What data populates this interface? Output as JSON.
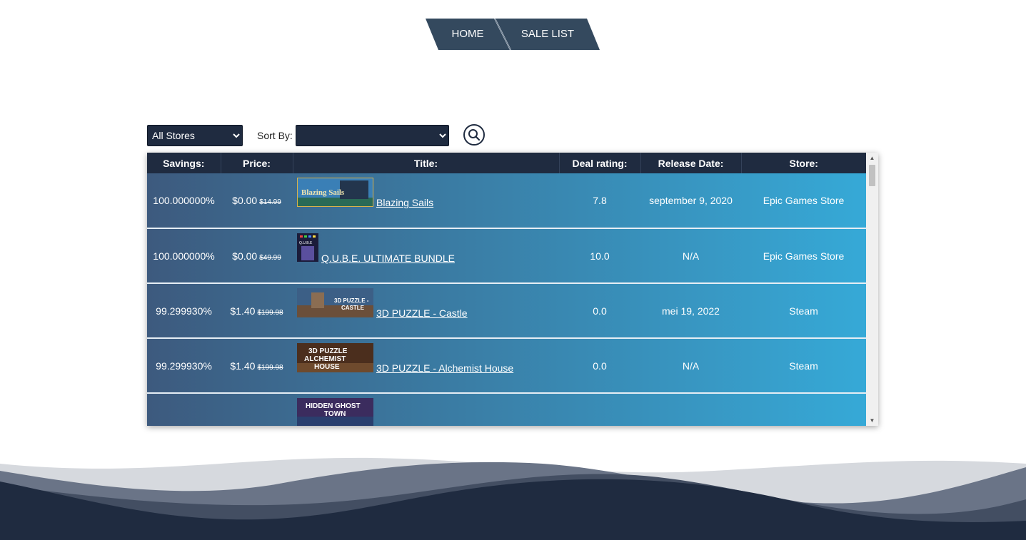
{
  "nav": {
    "home": "HOME",
    "sale_list": "SALE LIST"
  },
  "filters": {
    "store_selected": "All Stores",
    "sort_label": "Sort By:",
    "sort_selected": ""
  },
  "table": {
    "headers": [
      "Savings:",
      "Price:",
      "Title:",
      "Deal rating:",
      "Release Date:",
      "Store:"
    ],
    "rows": [
      {
        "savings": "100.000000%",
        "price": "$0.00",
        "old_price": "$14.99",
        "title": "Blazing Sails",
        "thumb_text": "Blazing Sails",
        "rating": "7.8",
        "release": "september 9, 2020",
        "store": "Epic Games Store"
      },
      {
        "savings": "100.000000%",
        "price": "$0.00",
        "old_price": "$49.99",
        "title": "Q.U.B.E. ULTIMATE BUNDLE",
        "thumb_text": "Q.U.B.E",
        "rating": "10.0",
        "release": "N/A",
        "store": "Epic Games Store"
      },
      {
        "savings": "99.299930%",
        "price": "$1.40",
        "old_price": "$199.98",
        "title": "3D PUZZLE - Castle",
        "thumb_text": "3D PUZZLE - CASTLE",
        "rating": "0.0",
        "release": "mei 19, 2022",
        "store": "Steam"
      },
      {
        "savings": "99.299930%",
        "price": "$1.40",
        "old_price": "$199.98",
        "title": "3D PUZZLE - Alchemist House",
        "thumb_text": "3D PUZZLE ALCHEMIST HOUSE",
        "rating": "0.0",
        "release": "N/A",
        "store": "Steam"
      },
      {
        "savings": "",
        "price": "",
        "old_price": "",
        "title": "",
        "thumb_text": "HIDDEN GHOST TOWN",
        "rating": "",
        "release": "",
        "store": ""
      }
    ]
  },
  "colors": {
    "navy": "#1f2b40",
    "nav_slate": "#34495e",
    "row_gradient_start": "#3d5a7e",
    "row_gradient_end": "#36a9d7"
  },
  "icons": {
    "search": "search-icon"
  }
}
